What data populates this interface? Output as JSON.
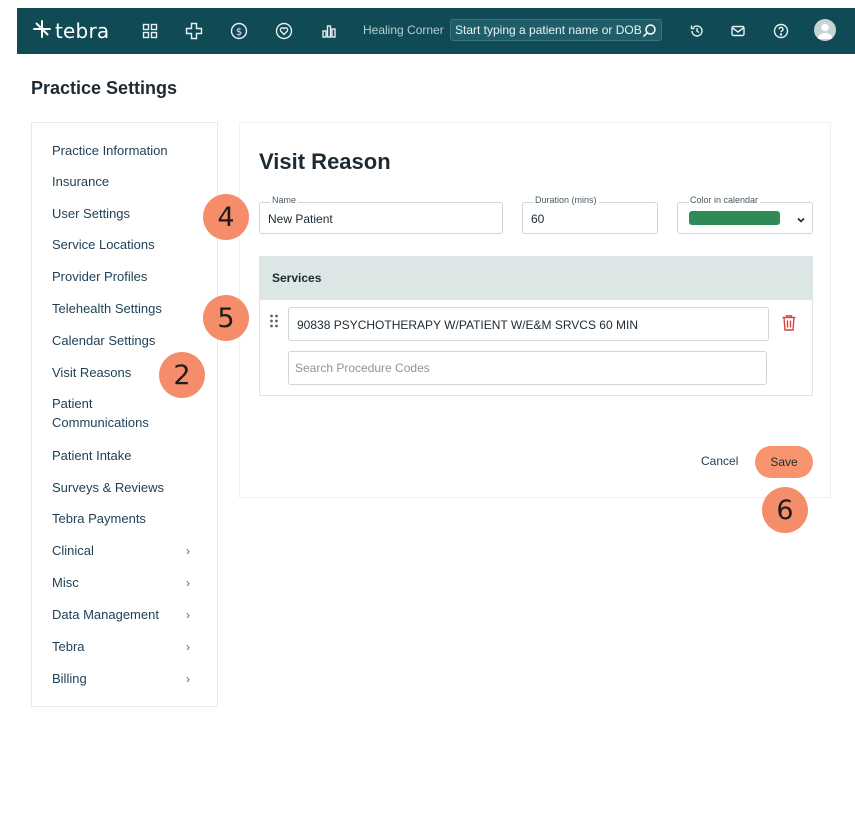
{
  "topbar": {
    "logo_text": "tebra",
    "practice_name": "Healing Corner",
    "search_placeholder": "Start typing a patient name or DOB",
    "nav_icons": [
      "grid-icon",
      "clinical-cross-icon",
      "dollar-icon",
      "heart-icon",
      "bar-chart-icon"
    ],
    "right_icons": [
      "history-icon",
      "mail-icon",
      "help-icon",
      "avatar"
    ]
  },
  "page": {
    "title": "Practice Settings"
  },
  "sidebar": {
    "items": [
      {
        "label": "Practice Information",
        "chevron": false
      },
      {
        "label": "Insurance",
        "chevron": false
      },
      {
        "label": "User Settings",
        "chevron": false
      },
      {
        "label": "Service Locations",
        "chevron": false
      },
      {
        "label": "Provider Profiles",
        "chevron": false
      },
      {
        "label": "Telehealth Settings",
        "chevron": false
      },
      {
        "label": "Calendar Settings",
        "chevron": false
      },
      {
        "label": "Visit Reasons",
        "chevron": false
      },
      {
        "label": "Patient Communications",
        "chevron": false
      },
      {
        "label": "Patient Intake",
        "chevron": false
      },
      {
        "label": "Surveys & Reviews",
        "chevron": false
      },
      {
        "label": "Tebra Payments",
        "chevron": false
      },
      {
        "label": "Clinical",
        "chevron": true
      },
      {
        "label": "Misc",
        "chevron": true
      },
      {
        "label": "Data Management",
        "chevron": true
      },
      {
        "label": "Tebra",
        "chevron": true
      },
      {
        "label": "Billing",
        "chevron": true
      }
    ],
    "patient_comm_line1": "Patient",
    "patient_comm_line2": "Communications",
    "chevron_glyph": "›"
  },
  "visit_reason": {
    "title": "Visit Reason",
    "name_label": "Name",
    "name_value": "New Patient",
    "duration_label": "Duration (mins)",
    "duration_value": "60",
    "color_label": "Color in calendar",
    "color_value": "#2e8b57",
    "services_header": "Services",
    "service_item": "90838 PSYCHOTHERAPY W/PATIENT W/E&M SRVCS 60 MIN",
    "procedure_search_placeholder": "Search Procedure Codes",
    "cancel_label": "Cancel",
    "save_label": "Save"
  },
  "callouts": {
    "sidebar_step": "2",
    "name_step": "4",
    "service_step": "5",
    "save_step": "6"
  },
  "colors": {
    "topbar": "#0f4a55",
    "accent": "#f7946e",
    "callout": "#f58d6b",
    "services_header_bg": "#dce6e4",
    "trash": "#d9433a"
  }
}
